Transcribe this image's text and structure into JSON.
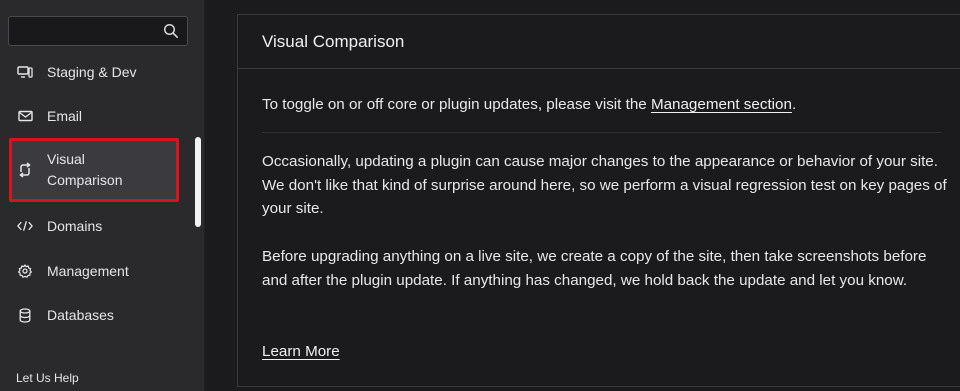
{
  "sidebar": {
    "search": {
      "value": "",
      "placeholder": ""
    },
    "items": [
      {
        "label": "Staging & Dev",
        "icon": "monitor-icon"
      },
      {
        "label": "Email",
        "icon": "envelope-icon"
      },
      {
        "label": "Visual Comparison",
        "icon": "sync-arrows-icon",
        "active": true
      },
      {
        "label": "Domains",
        "icon": "code-icon"
      },
      {
        "label": "Management",
        "icon": "gear-icon"
      },
      {
        "label": "Databases",
        "icon": "database-icon"
      }
    ],
    "help_label": "Let Us Help"
  },
  "panel": {
    "title": "Visual Comparison",
    "intro_prefix": "To toggle on or off core or plugin updates, please visit the ",
    "intro_link": "Management section",
    "intro_suffix": ".",
    "paragraph_1": "Occasionally, updating a plugin can cause major changes to the appearance or behavior of your site. We don't like that kind of surprise around here, so we perform a visual regression test on key pages of your site.",
    "paragraph_2": "Before upgrading anything on a live site, we create a copy of the site, then take screenshots before and after the plugin update. If anything has changed, we hold back the update and let you know.",
    "learn_more": "Learn More"
  },
  "colors": {
    "highlight_border": "#d9131b",
    "sidebar_bg": "#2a2a2d",
    "panel_bg": "#1b1b1e"
  }
}
